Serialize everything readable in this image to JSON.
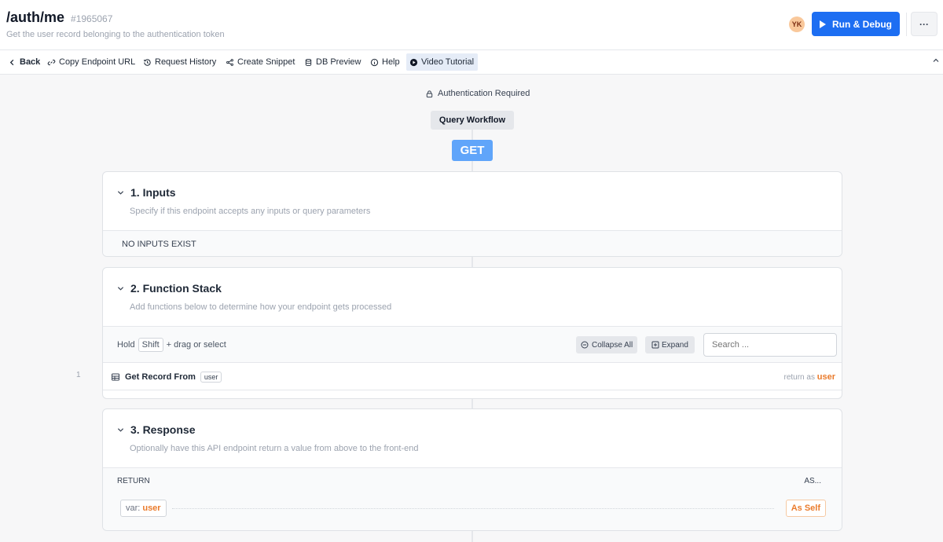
{
  "header": {
    "title": "/auth/me",
    "id": "#1965067",
    "subtitle": "Get the user record belonging to the authentication token",
    "avatar_initials": "YK",
    "run_label": "Run & Debug",
    "more_label": "···"
  },
  "toolbar": {
    "items": [
      {
        "label": "Back",
        "icon": "chevron-left-icon"
      },
      {
        "label": "Copy Endpoint URL",
        "icon": "link-icon"
      },
      {
        "label": "Request History",
        "icon": "history-icon"
      },
      {
        "label": "Create Snippet",
        "icon": "share-icon"
      },
      {
        "label": "DB Preview",
        "icon": "database-icon"
      },
      {
        "label": "Help",
        "icon": "info-icon"
      },
      {
        "label": "Video Tutorial",
        "icon": "play-circle-icon",
        "active": true
      }
    ],
    "collapse_icon": "chevron-up-icon"
  },
  "flow": {
    "auth_label": "Authentication Required",
    "workflow_label": "Query Workflow",
    "method": "GET"
  },
  "sections": {
    "inputs": {
      "title": "1. Inputs",
      "description": "Specify if this endpoint accepts any inputs or query parameters",
      "empty_text": "NO INPUTS EXIST"
    },
    "function_stack": {
      "title": "2. Function Stack",
      "description": "Add functions below to determine how your endpoint gets processed",
      "hold_text_1": "Hold",
      "hold_key": "Shift",
      "hold_text_2": "+ drag or select",
      "collapse_all_label": "Collapse All",
      "expand_label": "Expand",
      "search_placeholder": "Search ...",
      "functions": [
        {
          "index": "1",
          "name": "Get Record From",
          "table": "user",
          "return_prefix": "return as",
          "return_var": "user"
        }
      ]
    },
    "response": {
      "title": "3. Response",
      "description": "Optionally have this API endpoint return a value from above to the front-end",
      "return_header": "RETURN",
      "as_header": "AS...",
      "var_prefix": "var:",
      "var_name": "user",
      "as_value": "As Self"
    }
  },
  "colors": {
    "accent_blue": "#1d6ef2",
    "get_badge": "#60a5fa",
    "var_orange": "#ea7b2c"
  }
}
